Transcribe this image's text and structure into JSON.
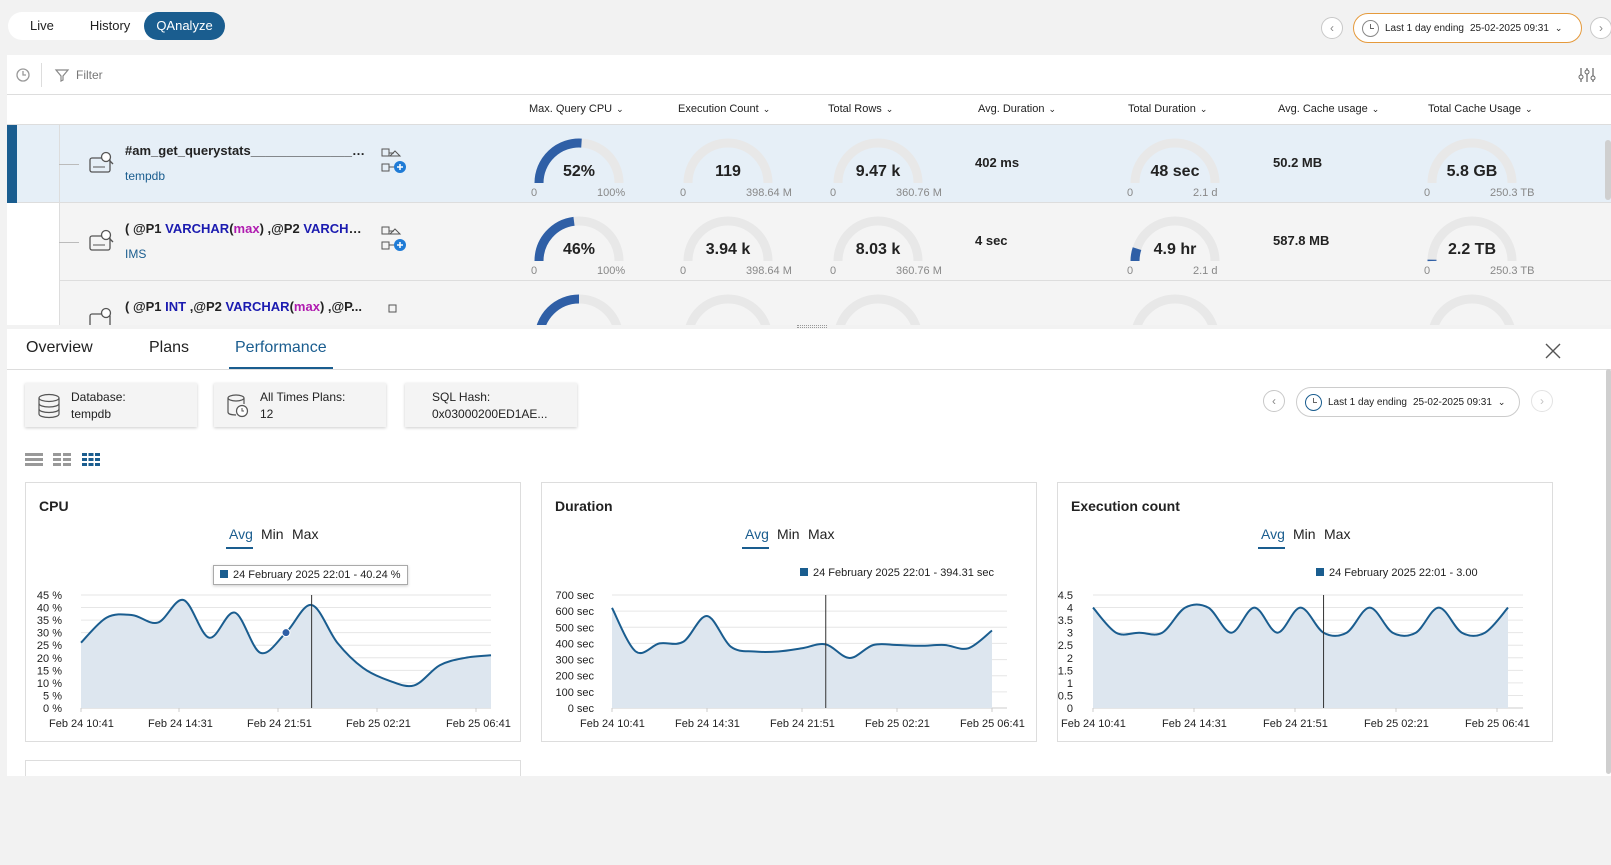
{
  "mode_tabs": [
    "Live",
    "History",
    "QAnalyze"
  ],
  "time_range": {
    "label": "Last 1 day ending",
    "value": "25-02-2025 09:31"
  },
  "filter": {
    "placeholder": "Filter"
  },
  "columns": [
    "Max. Query CPU",
    "Execution Count",
    "Total Rows",
    "Avg. Duration",
    "Total Duration",
    "Avg. Cache usage",
    "Total Cache Usage"
  ],
  "rows": [
    {
      "title": "#am_get_querystats___________________",
      "db": "tempdb",
      "cpu": {
        "value": "52%",
        "min": "0",
        "max": "100%",
        "fraction": 0.52
      },
      "exec": {
        "value": "119",
        "min": "0",
        "max": "398.64 M",
        "fraction": 0.0
      },
      "rows": {
        "value": "9.47 k",
        "min": "0",
        "max": "360.76 M",
        "fraction": 0.0
      },
      "avg_duration": "402 ms",
      "total_duration": {
        "value": "48 sec",
        "min": "0",
        "max": "2.1 d",
        "fraction": 0.0
      },
      "avg_cache": "50.2 MB",
      "total_cache": {
        "value": "5.8 GB",
        "min": "0",
        "max": "250.3 TB",
        "fraction": 0.0
      }
    },
    {
      "title_parts": [
        {
          "t": "( @P1 ",
          "c": ""
        },
        {
          "t": "VARCHAR",
          "c": "kw"
        },
        {
          "t": "(",
          "c": ""
        },
        {
          "t": "max",
          "c": "fn"
        },
        {
          "t": ") ,@P2 ",
          "c": ""
        },
        {
          "t": "VARCHA...",
          "c": "kw"
        }
      ],
      "db": "IMS",
      "cpu": {
        "value": "46%",
        "min": "0",
        "max": "100%",
        "fraction": 0.46
      },
      "exec": {
        "value": "3.94 k",
        "min": "0",
        "max": "398.64 M",
        "fraction": 0.0
      },
      "rows": {
        "value": "8.03 k",
        "min": "0",
        "max": "360.76 M",
        "fraction": 0.0
      },
      "avg_duration": "4 sec",
      "total_duration": {
        "value": "4.9 hr",
        "min": "0",
        "max": "2.1 d",
        "fraction": 0.1
      },
      "avg_cache": "587.8 MB",
      "total_cache": {
        "value": "2.2 TB",
        "min": "0",
        "max": "250.3 TB",
        "fraction": 0.01
      }
    },
    {
      "title_parts": [
        {
          "t": "( @P1 ",
          "c": ""
        },
        {
          "t": "INT",
          "c": "kw"
        },
        {
          "t": " ,@P2 ",
          "c": ""
        },
        {
          "t": "VARCHAR",
          "c": "kw"
        },
        {
          "t": "(",
          "c": ""
        },
        {
          "t": "max",
          "c": "fn"
        },
        {
          "t": ") ,@P...",
          "c": ""
        }
      ]
    }
  ],
  "detail_tabs": [
    "Overview",
    "Plans",
    "Performance"
  ],
  "info_cards": [
    {
      "label": "Database:",
      "value": "tempdb"
    },
    {
      "label": "All Times Plans:",
      "value": "12"
    },
    {
      "label": "SQL Hash:",
      "value": "0x03000200ED1AE..."
    }
  ],
  "agg_options": [
    "Avg",
    "Min",
    "Max"
  ],
  "charts": [
    {
      "title": "CPU",
      "tooltip": "24 February 2025 22:01 - 40.24 %"
    },
    {
      "title": "Duration",
      "tooltip": "24 February 2025 22:01 - 394.31 sec"
    },
    {
      "title": "Execution count",
      "tooltip": "24 February 2025 22:01 - 3.00"
    }
  ],
  "chart_data": [
    {
      "type": "area",
      "title": "CPU",
      "x_ticks": [
        "Feb 24 10:41",
        "Feb 24 14:31",
        "Feb 24 21:51",
        "Feb 25 02:21",
        "Feb 25 06:41"
      ],
      "y_ticks": [
        "0 %",
        "5 %",
        "10 %",
        "15 %",
        "20 %",
        "25 %",
        "30 %",
        "35 %",
        "40 %",
        "45 %"
      ],
      "ylim": [
        0,
        45
      ],
      "grid": true,
      "series": [
        {
          "values": [
            26,
            36,
            37,
            34,
            43,
            28,
            38,
            22,
            30,
            41,
            26,
            16,
            11,
            9,
            17,
            20,
            21
          ]
        }
      ],
      "highlight_index": 9
    },
    {
      "type": "area",
      "title": "Duration",
      "x_ticks": [
        "Feb 24 10:41",
        "Feb 24 14:31",
        "Feb 24 21:51",
        "Feb 25 02:21",
        "Feb 25 06:41"
      ],
      "y_ticks": [
        "0 sec",
        "100 sec",
        "200 sec",
        "300 sec",
        "400 sec",
        "500 sec",
        "600 sec",
        "700 sec"
      ],
      "ylim": [
        0,
        700
      ],
      "grid": true,
      "series": [
        {
          "values": [
            620,
            350,
            400,
            410,
            570,
            380,
            350,
            350,
            370,
            394,
            310,
            390,
            390,
            385,
            390,
            370,
            480
          ]
        }
      ],
      "highlight_index": 9
    },
    {
      "type": "area",
      "title": "Execution count",
      "x_ticks": [
        "Feb 24 10:41",
        "Feb 24 14:31",
        "Feb 24 21:51",
        "Feb 25 02:21",
        "Feb 25 06:41"
      ],
      "y_ticks": [
        "0",
        "0.5",
        "1",
        "1.5",
        "2",
        "2.5",
        "3",
        "3.5",
        "4",
        "4.5"
      ],
      "ylim": [
        0,
        4.5
      ],
      "grid": true,
      "series": [
        {
          "values": [
            4,
            3,
            3,
            3,
            4,
            4,
            3,
            4,
            3,
            4,
            3,
            3,
            4,
            3,
            3,
            4,
            3,
            3,
            4
          ]
        }
      ],
      "highlight_index": 10
    }
  ]
}
